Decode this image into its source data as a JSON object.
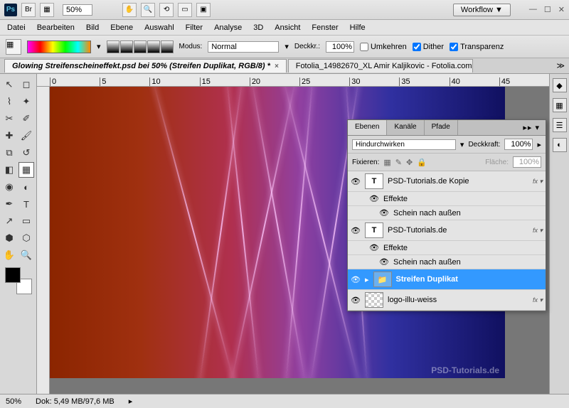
{
  "titlebar": {
    "zoom": "50%",
    "workflow": "Workflow ▼"
  },
  "menu": [
    "Datei",
    "Bearbeiten",
    "Bild",
    "Ebene",
    "Auswahl",
    "Filter",
    "Analyse",
    "3D",
    "Ansicht",
    "Fenster",
    "Hilfe"
  ],
  "options": {
    "modus_label": "Modus:",
    "modus_value": "Normal",
    "opacity_label": "Deckkr.:",
    "opacity_value": "100%",
    "reverse": "Umkehren",
    "dither": "Dither",
    "transparency": "Transparenz"
  },
  "tabs": [
    {
      "label": "Glowing Streifenscheineffekt.psd bei 50% (Streifen Duplikat, RGB/8) *",
      "active": true
    },
    {
      "label": "Fotolia_14982670_XL Amir Kaljikovic - Fotolia.com",
      "active": false
    }
  ],
  "ruler_marks": [
    "0",
    "5",
    "10",
    "15",
    "20",
    "25",
    "30",
    "35",
    "40",
    "45"
  ],
  "panel": {
    "tabs": [
      "Ebenen",
      "Kanäle",
      "Pfade"
    ],
    "blend": "Hindurchwirken",
    "opacity_label": "Deckkraft:",
    "opacity": "100%",
    "lock_label": "Fixieren:",
    "fill_label": "Fläche:",
    "fill": "100%"
  },
  "layers": [
    {
      "name": "PSD-Tutorials.de Kopie",
      "type": "T",
      "fx": true
    },
    {
      "name": "Effekte",
      "type": "sub"
    },
    {
      "name": "Schein nach außen",
      "type": "sub2"
    },
    {
      "name": "PSD-Tutorials.de",
      "type": "T",
      "fx": true
    },
    {
      "name": "Effekte",
      "type": "sub"
    },
    {
      "name": "Schein nach außen",
      "type": "sub2"
    },
    {
      "name": "Streifen Duplikat",
      "type": "folder",
      "selected": true
    },
    {
      "name": "logo-illu-weiss",
      "type": "img",
      "fx": true
    }
  ],
  "status": {
    "zoom": "50%",
    "doc": "Dok: 5,49 MB/97,6 MB"
  },
  "watermark": "PSD-Tutorials.de"
}
